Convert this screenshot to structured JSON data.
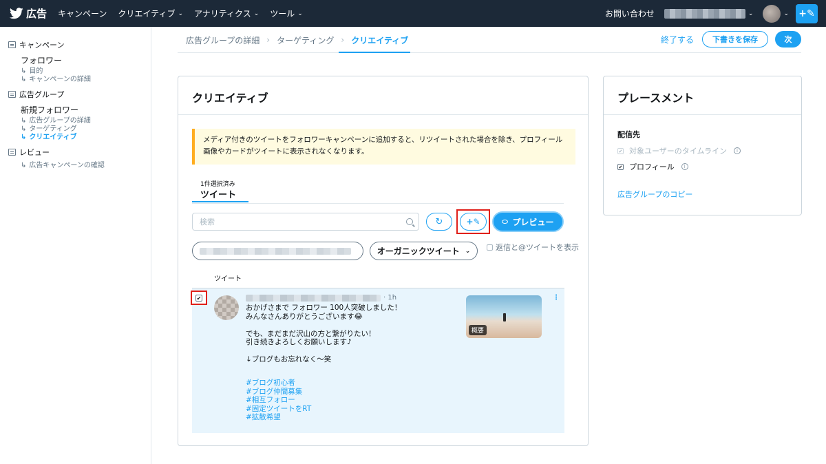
{
  "topbar": {
    "brand": "広告",
    "nav": [
      {
        "label": "キャンペーン",
        "dropdown": false
      },
      {
        "label": "クリエイティブ",
        "dropdown": true
      },
      {
        "label": "アナリティクス",
        "dropdown": true
      },
      {
        "label": "ツール",
        "dropdown": true
      }
    ],
    "contact": "お問い合わせ",
    "compose_icon": "+✎"
  },
  "sidebar": {
    "sections": [
      {
        "label": "キャンペーン",
        "title": "フォロワー",
        "items": [
          "目的",
          "キャンペーンの詳細"
        ]
      },
      {
        "label": "広告グループ",
        "title": "新規フォロワー",
        "items": [
          "広告グループの詳細",
          "ターゲティング",
          "クリエイティブ"
        ]
      },
      {
        "label": "レビュー",
        "title": "",
        "items": [
          "広告キャンペーンの確認"
        ]
      }
    ],
    "arrow": "↳"
  },
  "breadcrumb": {
    "steps": [
      "広告グループの詳細",
      "ターゲティング",
      "クリエイティブ"
    ],
    "finish": "終了する",
    "save_draft": "下書きを保存",
    "next": "次"
  },
  "creative": {
    "title": "クリエイティブ",
    "notice": "メディア付きのツイートをフォロワーキャンペーンに追加すると、リツイートされた場合を除き、プロフィール画像やカードがツイートに表示されなくなります。",
    "tab_count": "1件選択済み",
    "tab_label": "ツイート",
    "search_placeholder": "検索",
    "refresh_icon": "↻",
    "compose_icon": "+✎",
    "preview_label": "プレビュー",
    "type_select": "オーガニックツイート",
    "reply_label": "返信と@ツイートを表示",
    "column_header": "ツイート",
    "tweet": {
      "checked": true,
      "check_mark": "✔",
      "time": "· 1h",
      "text": "おかげさまで フォロワー 100人突破しました！\nみんなさんありがとうございます😂\n\nでも、まだまだ沢山の方と繋がりたい！\n引き続きよろしくお願いします♪\n\n↓ブログもお忘れなく〜笑",
      "hashtags": [
        "#ブログ初心者",
        "#ブログ仲間募集",
        "#相互フォロー",
        "#固定ツイートをRT",
        "#拡散希望"
      ],
      "thumb_badge": "概要",
      "more_icon": "⋮"
    }
  },
  "placement": {
    "title": "プレースメント",
    "subtitle": "配信先",
    "options": [
      {
        "label": "対象ユーザーのタイムライン",
        "checked": true,
        "disabled": true
      },
      {
        "label": "プロフィール",
        "checked": true,
        "disabled": false
      }
    ],
    "info_icon": "i",
    "check_mark": "✔",
    "copy_link": "広告グループのコピー"
  },
  "colors": {
    "topbar": "#1c2938",
    "accent": "#1da1f2",
    "notice_bg": "#fffbe0",
    "notice_border": "#ffad1f",
    "highlight": "#e0201a",
    "row_bg": "#e8f5fd"
  }
}
